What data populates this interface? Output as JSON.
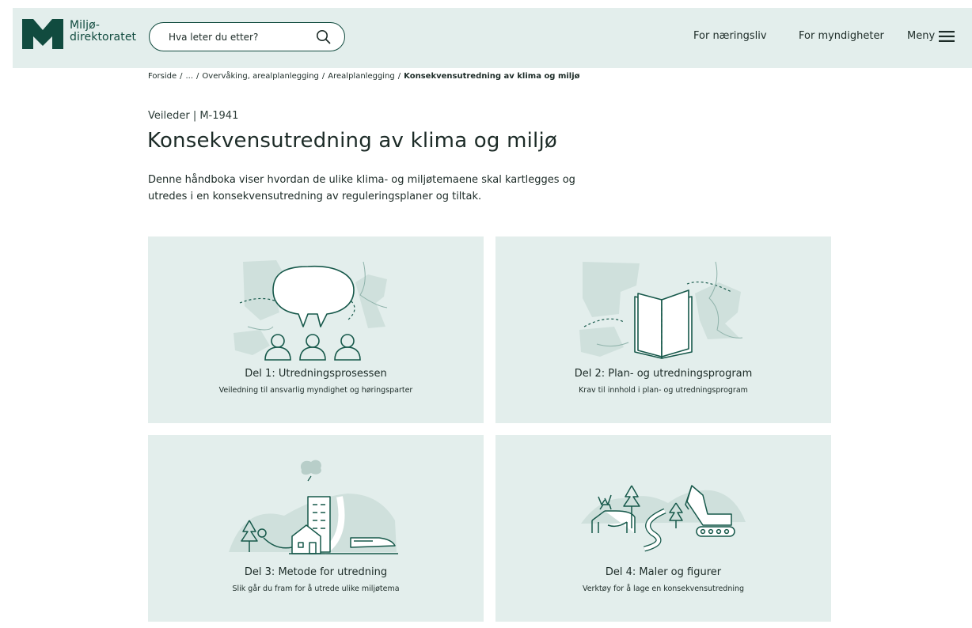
{
  "header": {
    "logo_line1": "Miljø-",
    "logo_line2": "direktoratet",
    "search_placeholder": "Hva leter du etter?",
    "nav": {
      "naeringsliv": "For næringsliv",
      "myndigheter": "For myndigheter",
      "meny": "Meny"
    }
  },
  "breadcrumb": {
    "items": [
      "Forside",
      "...",
      "Overvåking, arealplanlegging",
      "Arealplanlegging"
    ],
    "current": "Konsekvensutredning av klima og miljø",
    "separator": "/"
  },
  "page": {
    "doc_type": "Veileder | M-1941",
    "title": "Konsekvensutredning av klima og miljø",
    "intro": "Denne håndboka viser hvordan de ulike klima- og miljøtemaene skal kartlegges og utredes i en konsekvensutredning av reguleringsplaner og tiltak."
  },
  "cards": [
    {
      "title": "Del 1: Utredningsprosessen",
      "desc": "Veiledning til ansvarlig myndighet og høringsparter",
      "icon": "speech-bubble-people-icon"
    },
    {
      "title": "Del 2: Plan- og utredningsprogram",
      "desc": "Krav til innhold i plan- og utredningsprogram",
      "icon": "open-book-map-icon"
    },
    {
      "title": "Del 3: Metode for utredning",
      "desc": "Slik går du fram for å utrede ulike miljøtema",
      "icon": "town-train-landscape-icon"
    },
    {
      "title": "Del 4: Maler og figurer",
      "desc": "Verktøy for å lage en konsekvensutredning",
      "icon": "deer-excavator-landscape-icon"
    }
  ],
  "colors": {
    "brand": "#114b3f",
    "header_bg": "#e3eeec",
    "card_bg": "#e3eeec",
    "illustration_line": "#16584a",
    "illustration_fill": "#c9dcd8"
  }
}
